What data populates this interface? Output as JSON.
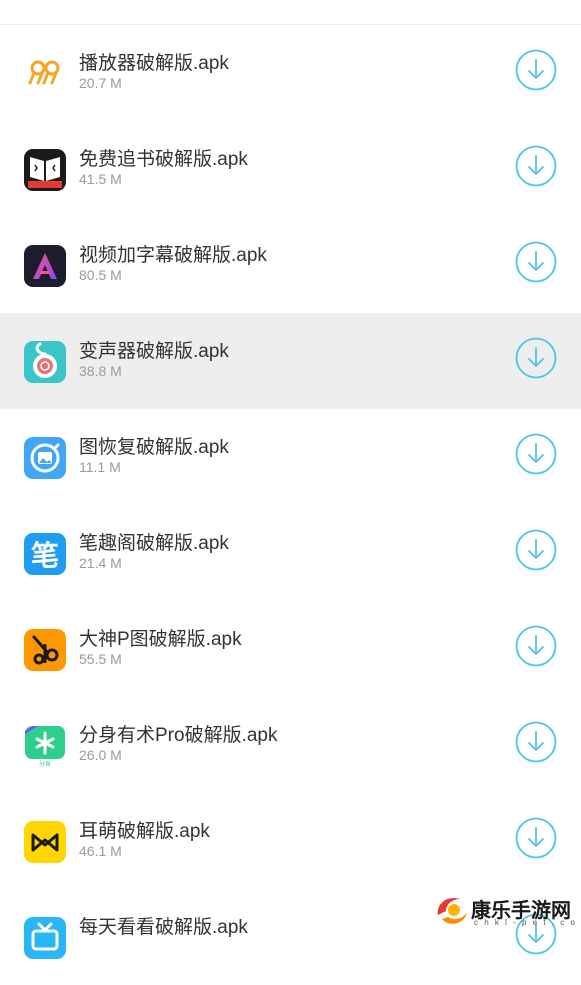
{
  "apps": [
    {
      "name": "播放器破解版.apk",
      "size": "20.7 M",
      "icon": "player-icon"
    },
    {
      "name": "免费追书破解版.apk",
      "size": "41.5 M",
      "icon": "book-icon"
    },
    {
      "name": "视频加字幕破解版.apk",
      "size": "80.5 M",
      "icon": "subtitle-app-icon"
    },
    {
      "name": "变声器破解版.apk",
      "size": "38.8 M",
      "icon": "voice-changer-icon",
      "selected": true
    },
    {
      "name": "图恢复破解版.apk",
      "size": "11.1 M",
      "icon": "photo-recovery-icon"
    },
    {
      "name": "笔趣阁破解版.apk",
      "size": "21.4 M",
      "icon": "biquge-icon"
    },
    {
      "name": "大神P图破解版.apk",
      "size": "55.5 M",
      "icon": "photo-edit-icon"
    },
    {
      "name": "分身有术Pro破解版.apk",
      "size": "26.0 M",
      "icon": "clone-app-icon"
    },
    {
      "name": "耳萌破解版.apk",
      "size": "46.1 M",
      "icon": "ermeng-icon"
    },
    {
      "name": "每天看看破解版.apk",
      "size": "",
      "icon": "tv-icon"
    }
  ],
  "watermark": {
    "text": "康乐手游网",
    "sub": "c h k l - p e t . c o m"
  },
  "colors": {
    "accent": "#4fc3e6",
    "selected_row": "#eeeeee"
  }
}
